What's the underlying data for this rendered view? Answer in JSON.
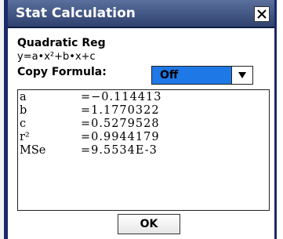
{
  "window": {
    "title": "Stat Calculation",
    "close_icon": "close-x-icon"
  },
  "regression": {
    "name": "Quadratic Reg",
    "formula": "y=a•x²+b•x+c"
  },
  "copy_formula": {
    "label": "Copy Formula:",
    "selected": "Off",
    "arrow_icon": "chevron-down-icon"
  },
  "results": [
    {
      "name": "a",
      "value": "=−0.114413"
    },
    {
      "name": "b",
      "value": "=1.1770322"
    },
    {
      "name": "c",
      "value": "=0.5279528"
    },
    {
      "name": "r²",
      "value": "=0.9944179"
    },
    {
      "name": "MSe",
      "value": "=9.5534E-3"
    }
  ],
  "buttons": {
    "ok": "OK"
  },
  "colors": {
    "title_bar": "#2f426f",
    "selection": "#1e78e6",
    "frame": "#1a2a6a"
  }
}
